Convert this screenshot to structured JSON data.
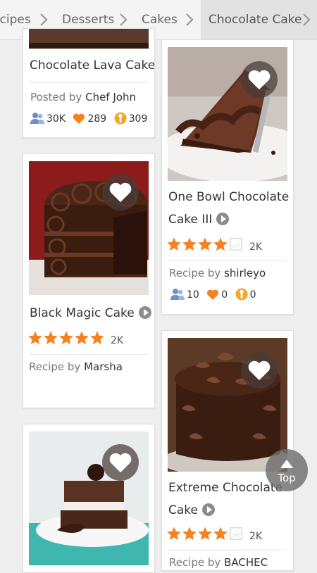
{
  "breadcrumb": {
    "items": [
      {
        "label": "Recipes"
      },
      {
        "label": "Desserts"
      },
      {
        "label": "Cakes"
      },
      {
        "label": "Chocolate Cake"
      }
    ]
  },
  "cards": {
    "lava": {
      "title": "Chocolate Lava Cake",
      "byline_prefix": "Posted by",
      "author": "Chef John",
      "followers": "30K",
      "favorites": "289",
      "madeit": "309"
    },
    "onebowl": {
      "title_line1": "One Bowl Chocolate",
      "title_line2": "Cake III",
      "rating": 4,
      "rating_count": "2K",
      "byline_prefix": "Recipe by",
      "author": "shirleyo",
      "followers": "10",
      "favorites": "0",
      "madeit": "0"
    },
    "blackmagic": {
      "title": "Black Magic Cake",
      "rating": 5,
      "rating_count": "2K",
      "byline_prefix": "Recipe by",
      "author": "Marsha"
    },
    "extreme": {
      "title_line1": "Extreme Chocolate",
      "title_line2": "Cake",
      "rating": 4,
      "rating_count": "2K",
      "byline_prefix": "Recipe by",
      "author": "BACHEC"
    }
  },
  "top_button": {
    "label": "Top"
  },
  "colors": {
    "accent_orange": "#f58220",
    "follower_blue": "#6b8fc7"
  }
}
